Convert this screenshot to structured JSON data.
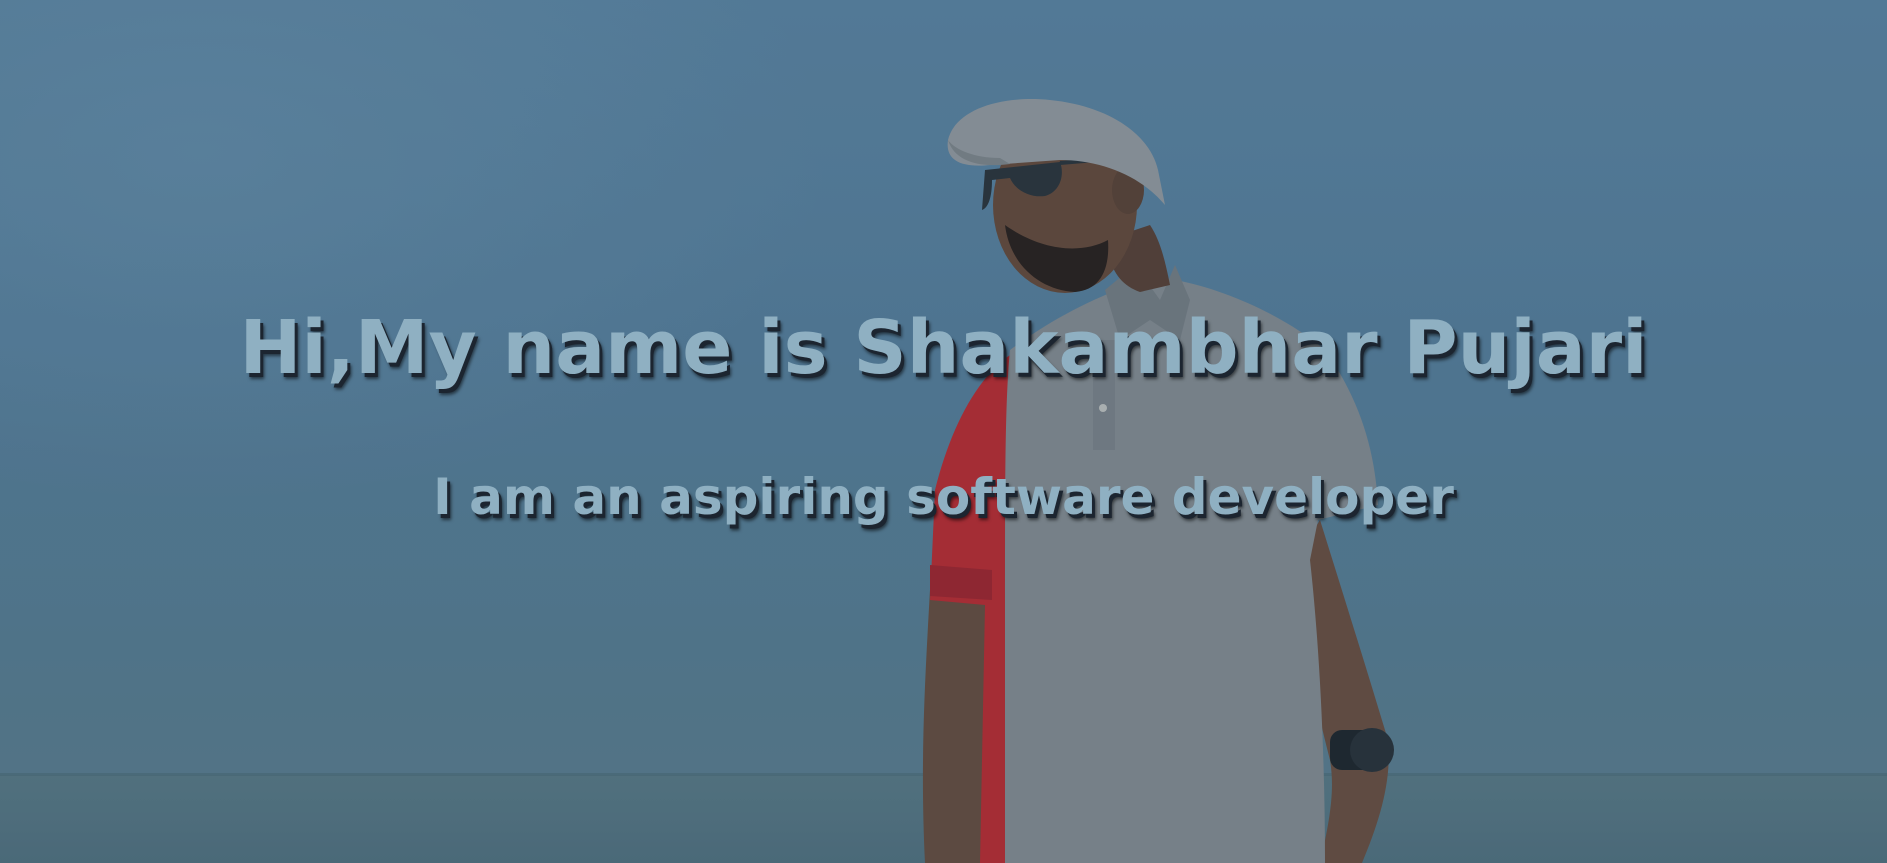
{
  "hero": {
    "title": "Hi,My name is Shakambhar Pujari",
    "subtitle": "I am an aspiring software developer"
  },
  "colors": {
    "sky": "#5f87a4",
    "text": "#8fb0c2",
    "shirt_gray": "#8a8f93",
    "shirt_red": "#c42a2e",
    "cap": "#9a9ea1"
  },
  "icons": {
    "photo": "person-photo"
  }
}
